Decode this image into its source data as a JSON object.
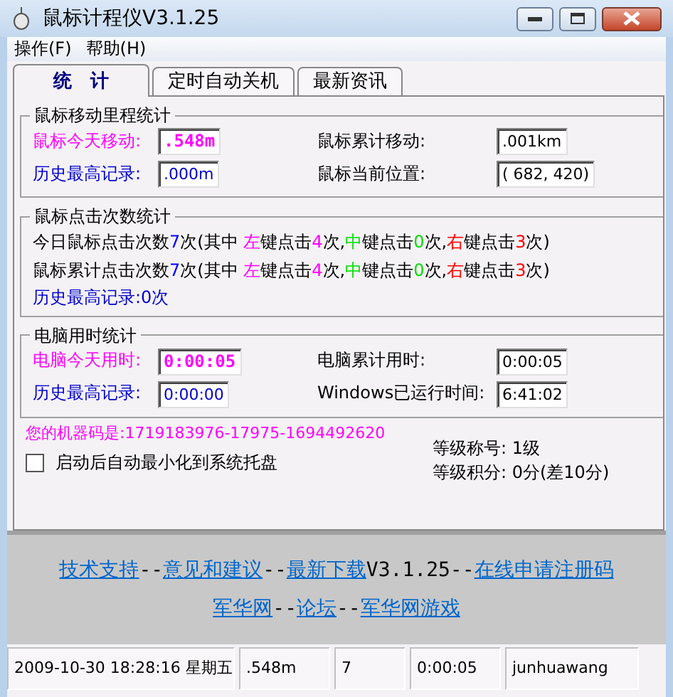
{
  "window": {
    "title": "鼠标计程仪V3.1.25"
  },
  "menu": [
    "操作(F)",
    "帮助(H)"
  ],
  "tabs": [
    {
      "label": "统　计",
      "selected": true
    },
    {
      "label": "定时自动关机",
      "selected": false
    },
    {
      "label": "最新资讯",
      "selected": false
    }
  ],
  "mileage": {
    "title": "鼠标移动里程统计",
    "fields": [
      {
        "label": "鼠标今天移动:",
        "value": ".548m",
        "kind": "today"
      },
      {
        "label": "鼠标累计移动:",
        "value": ".001km",
        "kind": "plain"
      },
      {
        "label": "历史最高记录:",
        "value": ".000m",
        "kind": "record"
      },
      {
        "label": "鼠标当前位置:",
        "value": "( 682, 420)",
        "kind": "plain"
      }
    ]
  },
  "clicks": {
    "title": "鼠标点击次数统计",
    "lines": [
      {
        "segments": [
          {
            "text": "今日鼠标点击次数",
            "color": "#000000"
          },
          {
            "text": "7",
            "color": "#0000ff"
          },
          {
            "text": "次(其中 ",
            "color": "#000000"
          },
          {
            "text": "左",
            "color": "#ff00ff"
          },
          {
            "text": "键点击",
            "color": "#000000"
          },
          {
            "text": "4",
            "color": "#ff00ff"
          },
          {
            "text": "次,",
            "color": "#000000"
          },
          {
            "text": "中",
            "color": "#00dd00"
          },
          {
            "text": "键点击",
            "color": "#000000"
          },
          {
            "text": "0",
            "color": "#00dd00"
          },
          {
            "text": "次,",
            "color": "#000000"
          },
          {
            "text": "右",
            "color": "#ff0000"
          },
          {
            "text": "键点击",
            "color": "#000000"
          },
          {
            "text": "3",
            "color": "#ff0000"
          },
          {
            "text": "次)",
            "color": "#000000"
          }
        ]
      },
      {
        "segments": [
          {
            "text": "鼠标累计点击次数",
            "color": "#000000"
          },
          {
            "text": "7",
            "color": "#0000ff"
          },
          {
            "text": "次(其中 ",
            "color": "#000000"
          },
          {
            "text": "左",
            "color": "#ff00ff"
          },
          {
            "text": "键点击",
            "color": "#000000"
          },
          {
            "text": "4",
            "color": "#ff00ff"
          },
          {
            "text": "次,",
            "color": "#000000"
          },
          {
            "text": "中",
            "color": "#00dd00"
          },
          {
            "text": "键点击",
            "color": "#000000"
          },
          {
            "text": "0",
            "color": "#00dd00"
          },
          {
            "text": "次,",
            "color": "#000000"
          },
          {
            "text": "右",
            "color": "#ff0000"
          },
          {
            "text": "键点击",
            "color": "#000000"
          },
          {
            "text": "3",
            "color": "#ff0000"
          },
          {
            "text": "次)",
            "color": "#000000"
          }
        ]
      }
    ],
    "record": "历史最高记录:0次"
  },
  "usage": {
    "title": "电脑用时统计",
    "fields": [
      {
        "label": "电脑今天用时:",
        "value": "0:00:05",
        "kind": "today"
      },
      {
        "label": "电脑累计用时:",
        "value": "0:00:05",
        "kind": "plain"
      },
      {
        "label": "历史最高记录:",
        "value": "0:00:00",
        "kind": "record"
      },
      {
        "label": "Windows已运行时间:",
        "value": "6:41:02",
        "kind": "plain"
      }
    ]
  },
  "machine_code": "您的机器码是:1719183976-17975-1694492620",
  "level_title": "等级称号: 1级",
  "autostart": {
    "label": "启动后自动最小化到系统托盘",
    "checked": false
  },
  "level_points": "等级积分: 0分(差10分)",
  "links": [
    [
      {
        "text": "技术支持",
        "kind": "link"
      },
      {
        "text": "--",
        "kind": "text"
      },
      {
        "text": "意见和建议",
        "kind": "link"
      },
      {
        "text": "--",
        "kind": "text"
      },
      {
        "text": "最新下载",
        "kind": "link"
      },
      {
        "text": "V3.1.25--",
        "kind": "text"
      },
      {
        "text": "在线申请注册码",
        "kind": "link"
      }
    ],
    [
      {
        "text": "军华网",
        "kind": "link"
      },
      {
        "text": "--",
        "kind": "text"
      },
      {
        "text": "论坛",
        "kind": "link"
      },
      {
        "text": "--",
        "kind": "text"
      },
      {
        "text": "军华网游戏",
        "kind": "link"
      }
    ]
  ],
  "status_bar": [
    "2009-10-30 18:28:16 星期五",
    ".548m",
    "7",
    "0:00:05",
    "junhuawang"
  ]
}
